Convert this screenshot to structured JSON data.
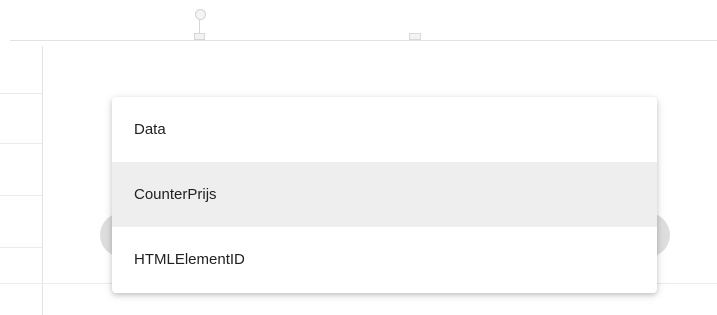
{
  "dropdown": {
    "items": [
      {
        "label": "Data",
        "highlighted": false
      },
      {
        "label": "CounterPrijs",
        "highlighted": true
      },
      {
        "label": "HTMLElementID",
        "highlighted": false
      }
    ],
    "highlight_color": "#eeeeee"
  },
  "background": {
    "pin_icon": "pin-icon",
    "marker_icon": "marker-icon"
  }
}
